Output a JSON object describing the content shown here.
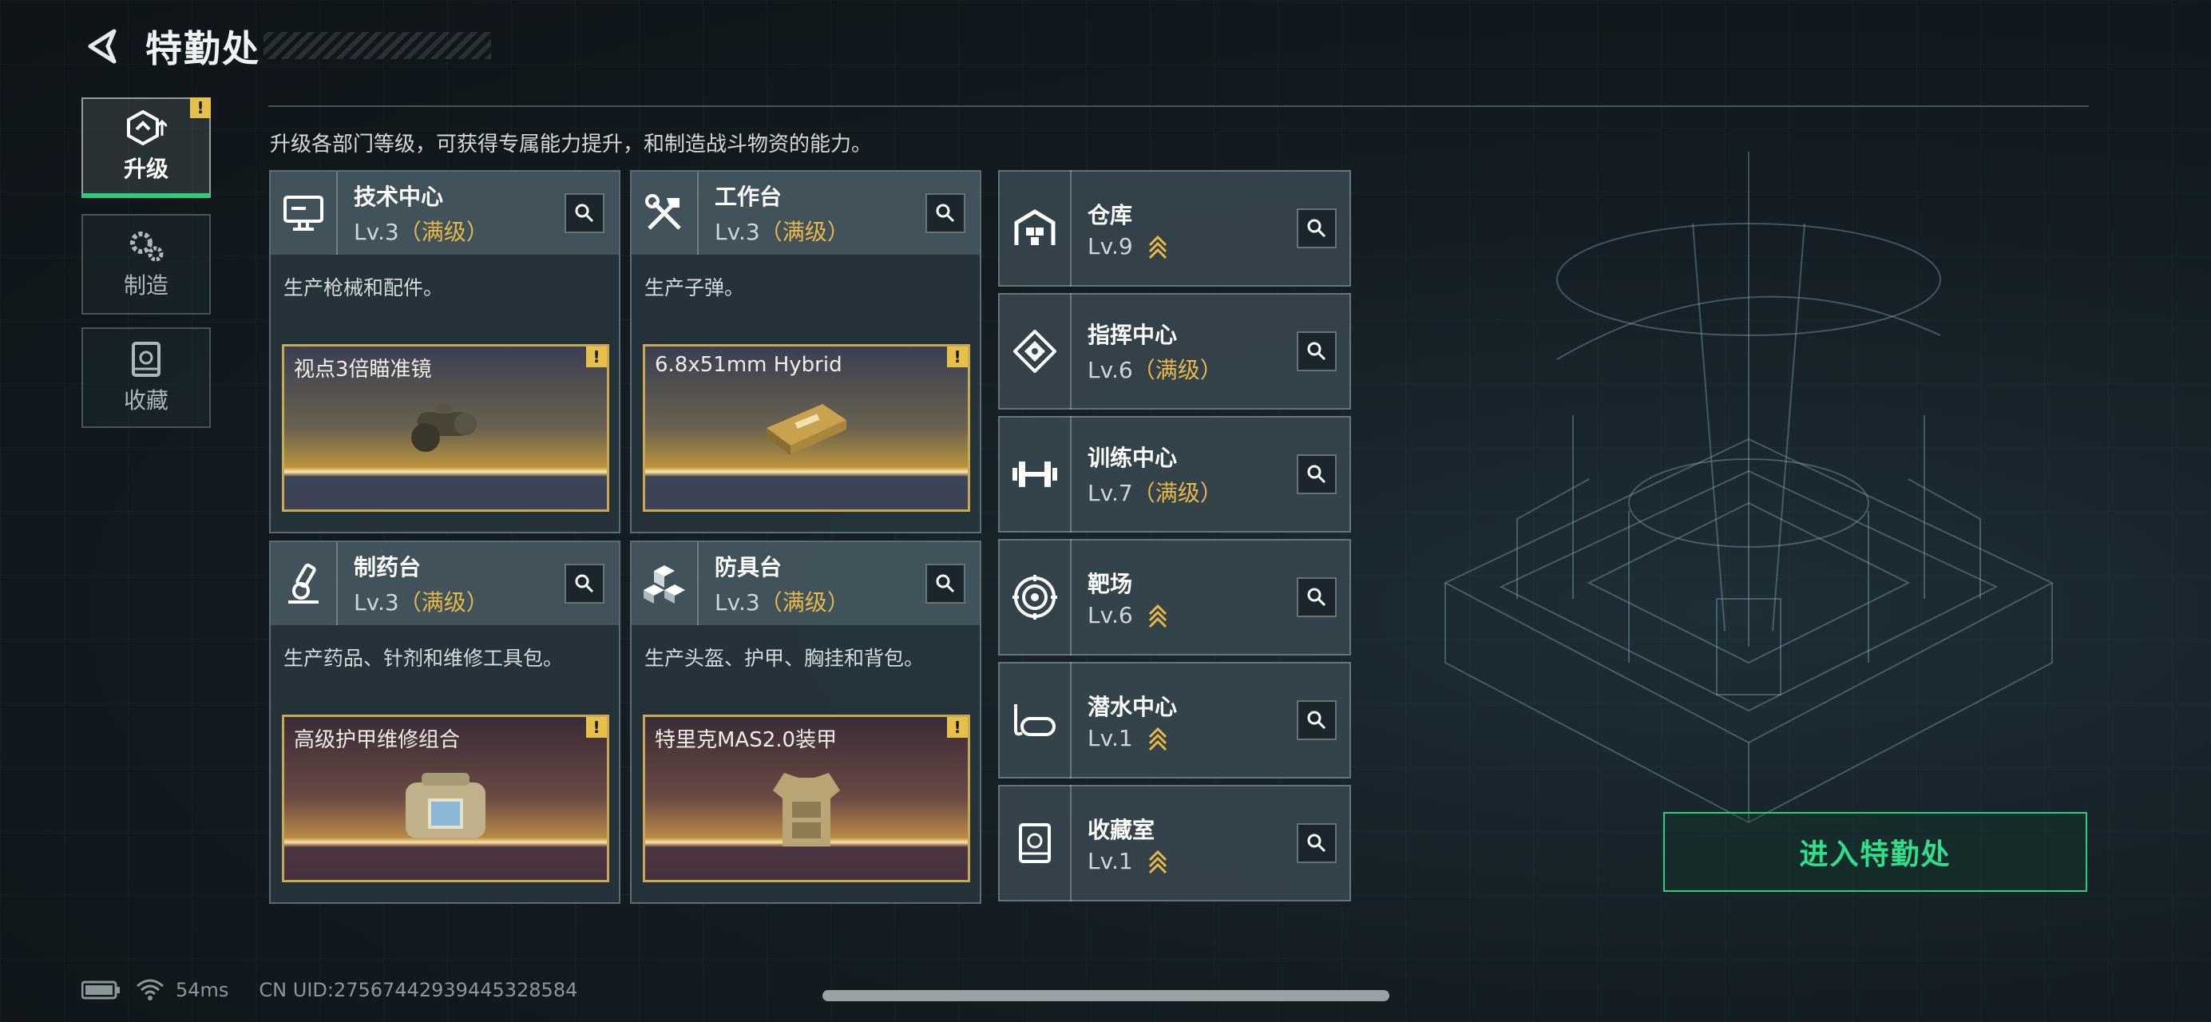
{
  "header": {
    "title": "特勤处"
  },
  "tabs": [
    {
      "label": "升级",
      "active": true,
      "badge": "!"
    },
    {
      "label": "制造",
      "active": false
    },
    {
      "label": "收藏",
      "active": false
    }
  ],
  "description": "升级各部门等级，可获得专属能力提升，和制造战斗物资的能力。",
  "cards": [
    {
      "name": "技术中心",
      "level": "Lv.3",
      "status": "（满级）",
      "text": "生产枪械和配件。",
      "product": "视点3倍瞄准镜",
      "badge": "!"
    },
    {
      "name": "工作台",
      "level": "Lv.3",
      "status": "（满级）",
      "text": "生产子弹。",
      "product": "6.8x51mm Hybrid",
      "badge": "!"
    },
    {
      "name": "制药台",
      "level": "Lv.3",
      "status": "（满级）",
      "text": "生产药品、针剂和维修工具包。",
      "product": "高级护甲维修组合",
      "badge": "!"
    },
    {
      "name": "防具台",
      "level": "Lv.3",
      "status": "（满级）",
      "text": "生产头盔、护甲、胸挂和背包。",
      "product": "特里克MAS2.0装甲",
      "badge": "!"
    }
  ],
  "facilities": [
    {
      "name": "仓库",
      "level": "Lv.9",
      "status": "",
      "upgradable": true,
      "icon": "warehouse-icon"
    },
    {
      "name": "指挥中心",
      "level": "Lv.6",
      "status": "（满级）",
      "upgradable": false,
      "icon": "command-icon"
    },
    {
      "name": "训练中心",
      "level": "Lv.7",
      "status": "（满级）",
      "upgradable": false,
      "icon": "dumbbell-icon"
    },
    {
      "name": "靶场",
      "level": "Lv.6",
      "status": "",
      "upgradable": true,
      "icon": "target-icon"
    },
    {
      "name": "潜水中心",
      "level": "Lv.1",
      "status": "",
      "upgradable": true,
      "icon": "diving-mask-icon"
    },
    {
      "name": "收藏室",
      "level": "Lv.1",
      "status": "",
      "upgradable": true,
      "icon": "collection-icon"
    }
  ],
  "enter_button": "进入特勤处",
  "footer": {
    "ping": "54ms",
    "uid": "CN UID:27567442939445328584"
  },
  "colors": {
    "accent_green": "#26d07c",
    "max_gold": "#e8b84a",
    "badge_yellow": "#e6c04b"
  }
}
